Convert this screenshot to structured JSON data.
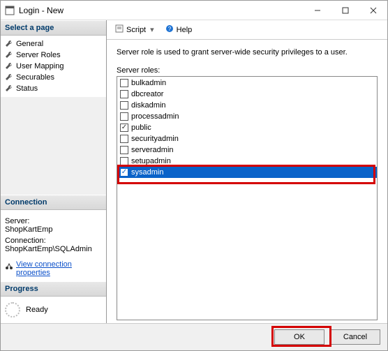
{
  "window": {
    "title": "Login - New"
  },
  "sidebar": {
    "pages_header": "Select a page",
    "pages": [
      {
        "label": "General"
      },
      {
        "label": "Server Roles"
      },
      {
        "label": "User Mapping"
      },
      {
        "label": "Securables"
      },
      {
        "label": "Status"
      }
    ],
    "connection_header": "Connection",
    "server_label": "Server:",
    "server_value": "ShopKartEmp",
    "connection_label": "Connection:",
    "connection_value": "ShopKartEmp\\SQLAdmin",
    "view_props": "View connection properties",
    "progress_header": "Progress",
    "progress_status": "Ready"
  },
  "toolbar": {
    "script": "Script",
    "help": "Help"
  },
  "main": {
    "description": "Server role is used to grant server-wide security privileges to a user.",
    "roles_label": "Server roles:",
    "roles": [
      {
        "name": "bulkadmin",
        "checked": false
      },
      {
        "name": "dbcreator",
        "checked": false
      },
      {
        "name": "diskadmin",
        "checked": false
      },
      {
        "name": "processadmin",
        "checked": false
      },
      {
        "name": "public",
        "checked": true
      },
      {
        "name": "securityadmin",
        "checked": false
      },
      {
        "name": "serveradmin",
        "checked": false
      },
      {
        "name": "setupadmin",
        "checked": false
      },
      {
        "name": "sysadmin",
        "checked": true
      }
    ]
  },
  "footer": {
    "ok": "OK",
    "cancel": "Cancel"
  }
}
